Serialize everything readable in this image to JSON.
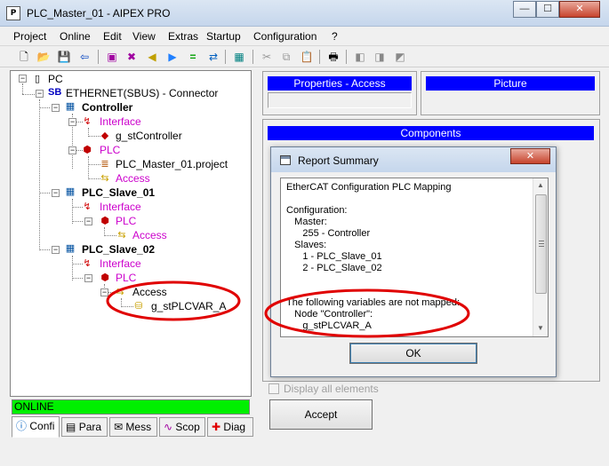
{
  "window": {
    "title": "PLC_Master_01 - AIPEX PRO",
    "app_icon": "P",
    "minimize": "—",
    "maximize": "☐",
    "close": "✕"
  },
  "menu": [
    "Project",
    "Online",
    "Edit",
    "View",
    "Extras",
    "Startup",
    "Configuration",
    "?"
  ],
  "toolbar_icons": [
    "new-file-icon",
    "open-folder-icon",
    "save-icon",
    "import-icon",
    "save-alt-icon",
    "cancel-icon",
    "arrow-left-icon",
    "arrow-right-icon",
    "equals-icon",
    "compare-icon",
    "calculator-icon",
    "cut-icon",
    "copy-icon",
    "paste-icon",
    "print-icon",
    "tool1-icon",
    "tool2-icon",
    "tool3-icon"
  ],
  "tree": {
    "root": "PC",
    "connector_prefix": "SB",
    "connector": "ETHERNET(SBUS) - Connector",
    "controller": "Controller",
    "controller_interface": "Interface",
    "controller_interface_var": "g_stController",
    "controller_plc": "PLC",
    "controller_plc_project": "PLC_Master_01.project",
    "controller_access": "Access",
    "slave1": "PLC_Slave_01",
    "slave1_interface": "Interface",
    "slave1_plc": "PLC",
    "slave1_access": "Access",
    "slave2": "PLC_Slave_02",
    "slave2_interface": "Interface",
    "slave2_plc": "PLC",
    "slave2_access": "Access",
    "slave2_access_var": "g_stPLCVAR_A"
  },
  "status": "ONLINE",
  "bottom_tabs": [
    "Confi",
    "Para",
    "Mess",
    "Scop",
    "Diag"
  ],
  "properties_header": "Properties - Access",
  "picture_header": "Picture",
  "components_header": "Components",
  "dialog": {
    "title": "Report Summary",
    "lines": [
      "EtherCAT Configuration PLC Mapping",
      "",
      "Configuration:",
      "   Master:",
      "      255 - Controller",
      "   Slaves:",
      "      1 - PLC_Slave_01",
      "      2 - PLC_Slave_02",
      "",
      "",
      "The following variables are not mapped:",
      "   Node \"Controller\":",
      "      g_stPLCVAR_A"
    ],
    "ok_label": "OK"
  },
  "display_all_label": "Display all elements",
  "accept_label": "Accept",
  "colors": {
    "blue_header": "#0000ff",
    "online_green": "#00f000",
    "annotation_red": "#e00000",
    "pink_node": "#cc00cc"
  }
}
